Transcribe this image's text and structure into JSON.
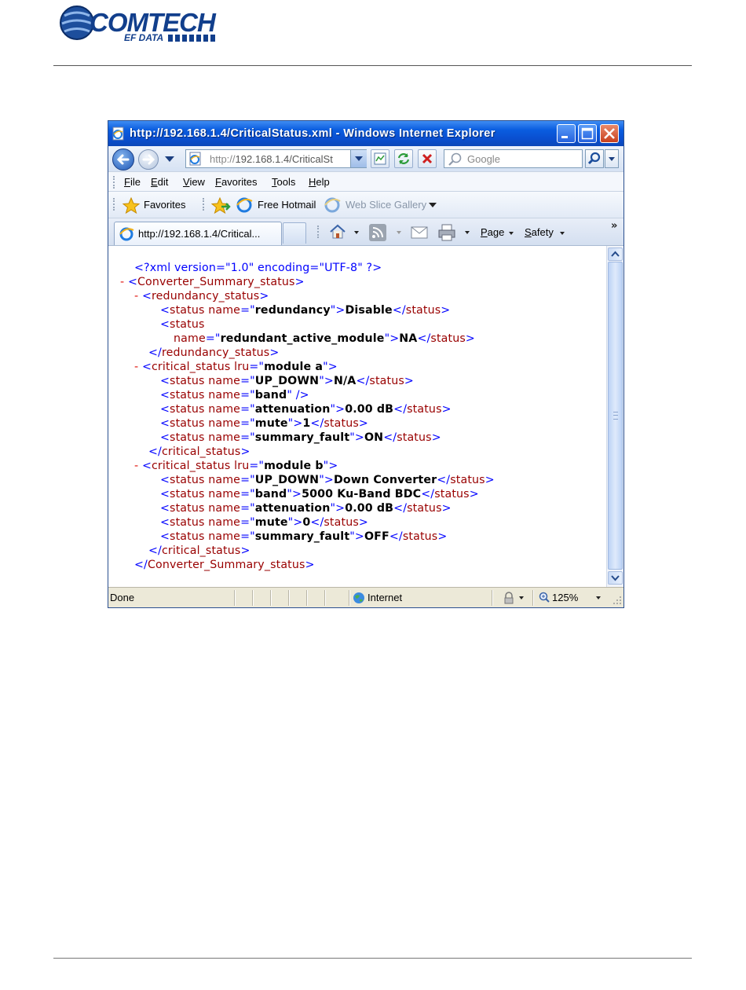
{
  "document": {
    "logo_text": "COMTECH",
    "logo_subtext": "EF DATA"
  },
  "browser": {
    "title": "http://192.168.1.4/CriticalStatus.xml - Windows Internet Explorer",
    "address_prefix": "http://",
    "address_host": "192.168.1.4/CriticalSt",
    "search_placeholder": "Google",
    "menu": [
      "File",
      "Edit",
      "View",
      "Favorites",
      "Tools",
      "Help"
    ],
    "favorites": {
      "favorites_label": "Favorites",
      "free_hotmail": "Free Hotmail",
      "web_slice_gallery": "Web Slice Gallery"
    },
    "tab_title": "http://192.168.1.4/Critical...",
    "commands": {
      "page": "Page",
      "safety": "Safety",
      "overflow": "»"
    },
    "status": {
      "text": "Done",
      "zone": "Internet",
      "zoom": "125%"
    }
  },
  "xml": {
    "declaration": "<?xml version=\"1.0\" encoding=\"UTF-8\" ?>",
    "root_tag": "Converter_Summary_status",
    "redundancy_tag": "redundancy_status",
    "critical_tag": "critical_status",
    "status_tag": "status",
    "attr_name": "name",
    "attr_lru": "lru",
    "collapse": "-",
    "redundancy": [
      {
        "name": "redundancy",
        "value": "Disable"
      },
      {
        "name": "redundant_active_module",
        "value": "NA"
      }
    ],
    "module_a": {
      "lru": "module a",
      "items": [
        {
          "name": "UP_DOWN",
          "value": "N/A"
        },
        {
          "name": "band",
          "value": ""
        },
        {
          "name": "attenuation",
          "value": "0.00 dB"
        },
        {
          "name": "mute",
          "value": "1"
        },
        {
          "name": "summary_fault",
          "value": "ON"
        }
      ]
    },
    "module_b": {
      "lru": "module b",
      "items": [
        {
          "name": "UP_DOWN",
          "value": "Down Converter"
        },
        {
          "name": "band",
          "value": "5000 Ku-Band BDC"
        },
        {
          "name": "attenuation",
          "value": "0.00 dB"
        },
        {
          "name": "mute",
          "value": "0"
        },
        {
          "name": "summary_fault",
          "value": "OFF"
        }
      ]
    }
  }
}
